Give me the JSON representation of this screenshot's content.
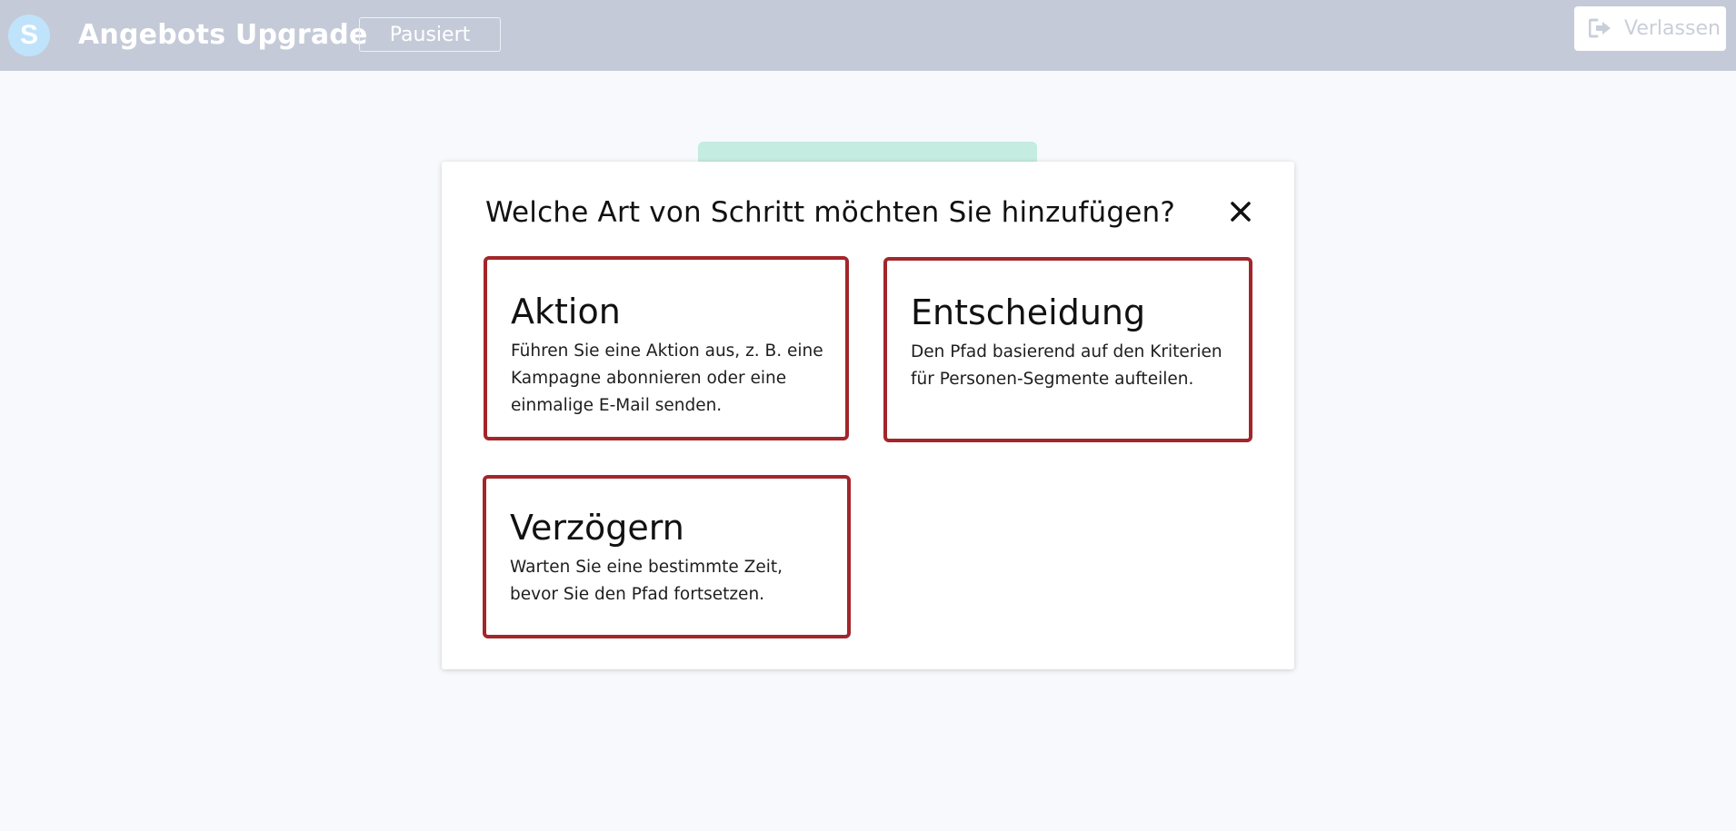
{
  "header": {
    "logo_letter": "S",
    "title": "Angebots Upgrade",
    "status_label": "Pausiert",
    "exit_label": "Verlassen"
  },
  "modal": {
    "title": "Welche Art von Schritt möchten Sie hinzufügen?",
    "close_icon": "close-icon",
    "options": [
      {
        "title": "Aktion",
        "description": "Führen Sie eine Aktion aus, z. B. eine Kampagne abonnieren oder eine einmalige E-Mail senden."
      },
      {
        "title": "Entscheidung",
        "description": "Den Pfad basierend auf den Kriterien für Personen-Segmente aufteilen."
      },
      {
        "title": "Verzögern",
        "description": "Warten Sie eine bestimmte Zeit, bevor Sie den Pfad fortsetzen."
      }
    ]
  },
  "colors": {
    "topbar": "#c4cad8",
    "card_border": "#a3262a",
    "logo": "#bfe3fb",
    "background": "#f7f9fc"
  }
}
